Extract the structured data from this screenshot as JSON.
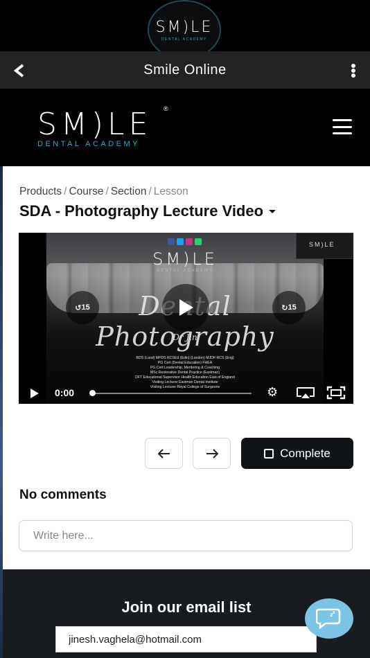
{
  "app": {
    "logo_text": "SM)LE",
    "logo_subtext": "DENTAL ACADEMY",
    "title": "Smile Online"
  },
  "site_header": {
    "brand_main": "SM)LE",
    "brand_sub": "DENTAL ACADEMY",
    "registered_mark": "®"
  },
  "breadcrumb": {
    "items": [
      "Products",
      "Course",
      "Section"
    ],
    "current": "Lesson"
  },
  "lesson": {
    "title": "SDA - Photography Lecture Video"
  },
  "video": {
    "overlay_logo": "SM)LE",
    "overlay_logo_sub": "DENTAL ACADEMY",
    "overlay_script_title": "Dental Photography",
    "overlay_signature": "Dr Jin",
    "overlay_credits": [
      "BDS (Lond) MFDS RCSEd (Edin) (London) MJDF RCS (Eng)",
      "PG Cert (Dental Education) FHEA",
      "PG Cert Leadership, Mentoring & Coaching",
      "MSc Restorative Dental Practice (Eastman)",
      "DFT Educational Supervisor Health Education East of England",
      "Visiting Lecturer Eastman Dental Institute",
      "Visiting Lecturer Royal College of Surgeons"
    ],
    "pip_text": "SM)LE",
    "skip_back_label": "15",
    "skip_forward_label": "15",
    "current_time": "0:00",
    "progress": 0
  },
  "navigation": {
    "prev_icon": "arrow-left-icon",
    "next_icon": "arrow-right-icon",
    "complete_label": "Complete"
  },
  "comments": {
    "title": "No comments",
    "placeholder": "Write here..."
  },
  "footer": {
    "join_title": "Join our email list",
    "email_value": "jinesh.vaghela@hotmail.com"
  },
  "colors": {
    "accent_teal": "#3aa7c2",
    "complete_button": "#101418",
    "chat_fab": "#7cc4e6",
    "footer_bg": "#181b1f",
    "nav_bar_bg": "#232323"
  }
}
